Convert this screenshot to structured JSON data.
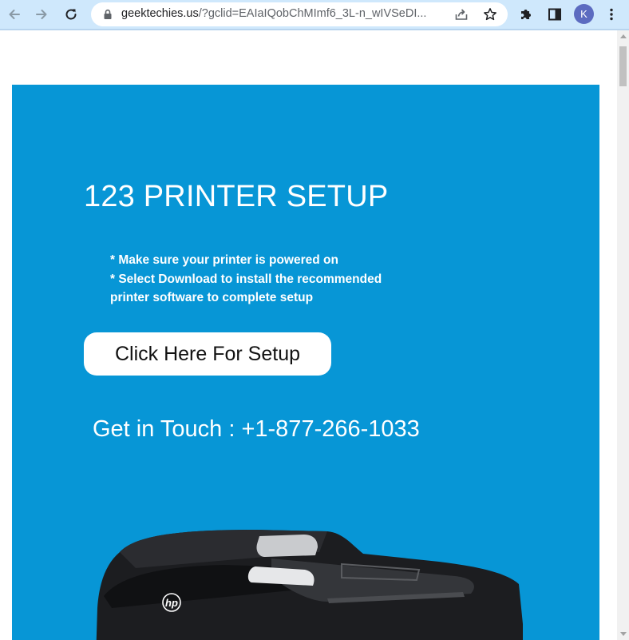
{
  "browser": {
    "url_host": "geektechies.us",
    "url_path": "/?gclid=EAIaIQobChMImf6_3L-n_wIVSeDI...",
    "profile_initial": "K",
    "icons": [
      "back-arrow-icon",
      "forward-arrow-icon",
      "reload-icon",
      "lock-icon",
      "share-icon",
      "star-icon",
      "extensions-puzzle-icon",
      "side-panel-icon",
      "kebab-menu-icon"
    ]
  },
  "page": {
    "hero_title": "123 PRINTER SETUP",
    "bullets": [
      "* Make sure your printer is powered on",
      "* Select Download to install the recommended",
      "printer software to complete setup"
    ],
    "setup_button_label": "Click Here For Setup",
    "contact_text": "Get in Touch : +1-877-266-1033",
    "printer_brand": "hp"
  },
  "colors": {
    "hero_background": "#0796d6",
    "browser_toolbar": "#cfe8fc",
    "button_background": "#ffffff"
  }
}
